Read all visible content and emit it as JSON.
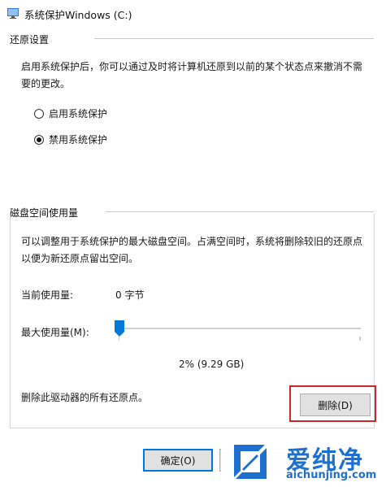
{
  "window": {
    "title": "系统保护Windows (C:)"
  },
  "restore_settings": {
    "title": "还原设置",
    "description_line1": "启用系统保护后，你可以通过及时将计算机还原到以前的某个状态点来撤消不需",
    "description_line2": "要的更改。",
    "options": [
      {
        "label": "启用系统保护",
        "checked": false
      },
      {
        "label": "禁用系统保护",
        "checked": true
      }
    ]
  },
  "disk_usage": {
    "title": "磁盘空间使用量",
    "description_line1": "可以调整用于系统保护的最大磁盘空间。占满空间时，系统将删除较旧的还原点",
    "description_line2": "以便为新还原点留出空间。",
    "current_label": "当前使用量:",
    "current_value": "0 字节",
    "max_label": "最大使用量(M):",
    "slider_percent": 2,
    "max_value_text": "2% (9.29 GB)",
    "delete_text": "删除此驱动器的所有还原点。",
    "delete_button": "删除(D)"
  },
  "footer": {
    "ok_button": "确定(O)"
  },
  "watermark": {
    "brand": "爱纯净",
    "url": "aichunjing.com"
  },
  "colors": {
    "accent": "#0078d7",
    "highlight": "#c8282b",
    "watermark": "#1d6fd0"
  }
}
